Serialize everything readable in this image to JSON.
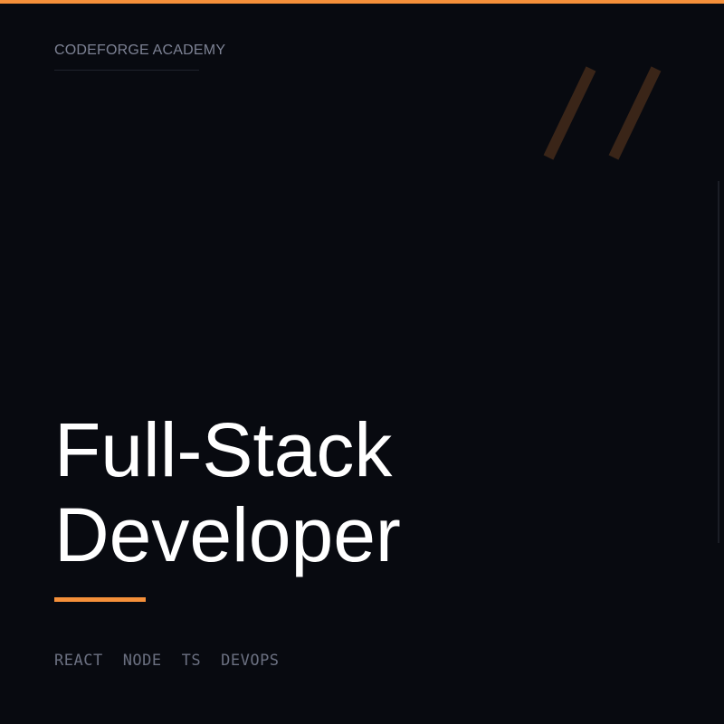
{
  "brand": {
    "name": "CODEFORGE ACADEMY"
  },
  "headline": {
    "line1": "Full-Stack",
    "line2": "Developer"
  },
  "tags": [
    "REACT",
    "NODE",
    "TS",
    "DEVOPS"
  ],
  "colors": {
    "background": "#080a10",
    "accent": "#f5903a",
    "headline_text": "#ffffff",
    "muted_text": "#7d8294",
    "slash_mark": "#3a2518"
  },
  "icons": {
    "decor": "double-slash-icon"
  }
}
